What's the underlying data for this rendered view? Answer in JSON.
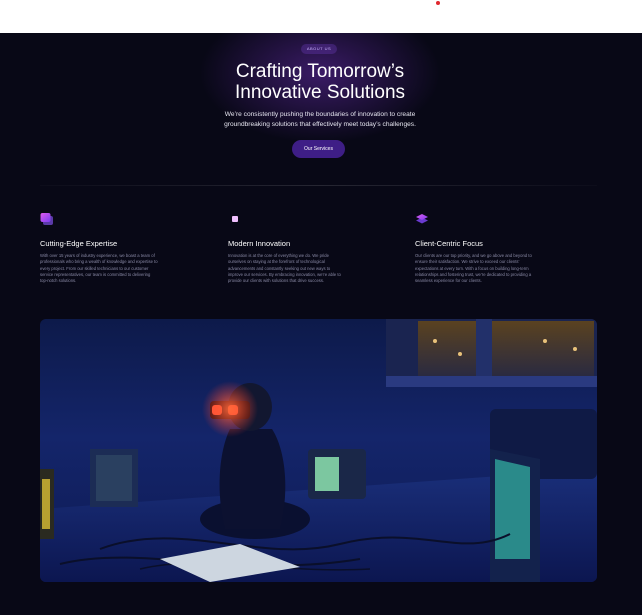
{
  "hero": {
    "eyebrow": "ABOUT US",
    "title_line1": "Crafting Tomorrow’s",
    "title_line2": "Innovative Solutions",
    "subtitle_line1": "We’re consistently pushing the boundaries of innovation to create",
    "subtitle_line2": "groundbreaking solutions that effectively meet today’s challenges.",
    "cta_label": "Our Services"
  },
  "features": [
    {
      "icon": "cube-stack-icon",
      "title": "Cutting-Edge Expertise",
      "desc_lines": [
        "With over 15 years of industry experience, we boast a team of",
        "professionals who bring a wealth of knowledge and expertise to",
        "every project. From our skilled technicians to our customer",
        "service representatives, our team is committed to delivering",
        "top-notch solutions."
      ]
    },
    {
      "icon": "chip-icon",
      "title": "Modern Innovation",
      "desc_lines": [
        "Innovation is at the core of everything we do. We pride",
        "ourselves on staying at the forefront of technological",
        "advancements and constantly seeking out new ways to",
        "improve our services. By embracing innovation, we’re able to",
        "provide our clients with solutions that drive success."
      ]
    },
    {
      "icon": "layers-icon",
      "title": "Client-Centric Focus",
      "desc_lines": [
        "Our clients are our top priority, and we go above and beyond to",
        "ensure their satisfaction. We strive to exceed our clients’",
        "expectations at every turn. With a focus on building long-term",
        "relationships and fostering trust, we’re dedicated to providing a",
        "seamless experience for our clients."
      ]
    }
  ],
  "colors": {
    "background": "#080816",
    "accent": "#3e1e86",
    "icon_gradient_start": "#e05cf0",
    "icon_gradient_end": "#7a3cf0"
  }
}
